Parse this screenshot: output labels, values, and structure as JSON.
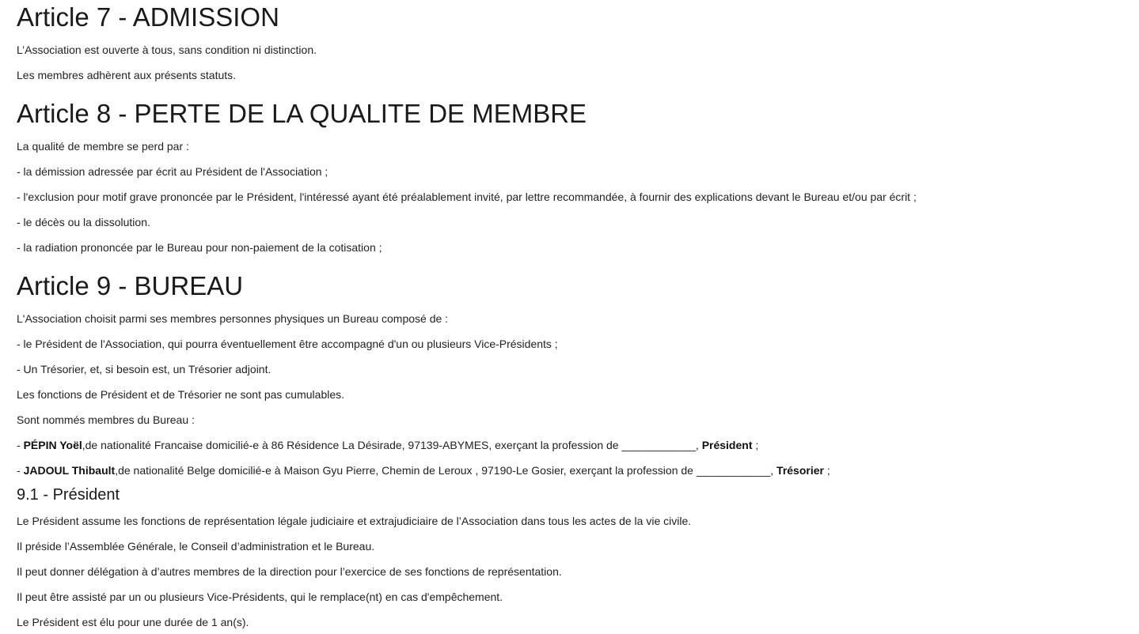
{
  "article7": {
    "title": "Article 7 - ADMISSION",
    "p1": "L’Association est ouverte à tous, sans condition ni distinction.",
    "p2": "Les membres adhèrent aux présents statuts."
  },
  "article8": {
    "title": "Article 8 - PERTE DE LA QUALITE DE MEMBRE",
    "intro": "La qualité de membre se perd par :",
    "items": [
      "- la démission adressée par écrit au Président de l'Association ;",
      "- l'exclusion pour motif grave prononcée par le Président, l'intéressé ayant été préalablement invité, par lettre recommandée, à fournir des explications devant le Bureau et/ou par écrit ;",
      "- le décès ou la dissolution.",
      "- la radiation prononcée par le Bureau pour non-paiement de la cotisation ;"
    ]
  },
  "article9": {
    "title": "Article 9 - BUREAU",
    "intro": "L'Association choisit parmi ses membres personnes physiques un Bureau composé de :",
    "items": [
      "- le Président de l'Association, qui pourra éventuellement être accompagné d'un ou plusieurs Vice-Présidents ;",
      "- Un Trésorier, et, si besoin est, un Trésorier adjoint."
    ],
    "cumul": "Les fonctions de Président et de Trésorier ne sont pas cumulables.",
    "named_intro": "Sont nommés membres du Bureau :",
    "members": [
      {
        "prefix": "- ",
        "name": "PÉPIN Yoël",
        "details": ",de nationalité Francaise domicilié-e à 86 Résidence La Désirade, 97139-ABYMES, exerçant la profession de ____________, ",
        "role": "Président",
        "suffix": " ;"
      },
      {
        "prefix": "- ",
        "name": "JADOUL Thibault",
        "details": ",de nationalité Belge domicilié-e à Maison Gyu Pierre, Chemin de Leroux , 97190-Le Gosier, exerçant la profession de ____________, ",
        "role": "Trésorier",
        "suffix": " ;"
      }
    ]
  },
  "section91": {
    "title": "9.1 - Président",
    "lines": [
      "Le Président assume les fonctions de représentation légale judiciaire et extrajudiciaire de l’Association dans tous les actes de la vie civile.",
      "Il préside l’Assemblée Générale, le Conseil d’administration et le Bureau.",
      "Il peut donner délégation à d’autres membres de la direction pour l’exercice de ses fonctions de représentation.",
      "Il peut être assisté par un ou plusieurs Vice-Présidents, qui le remplace(nt) en cas d'empêchement.",
      "Le Président est élu pour une durée de 1 an(s)."
    ]
  }
}
